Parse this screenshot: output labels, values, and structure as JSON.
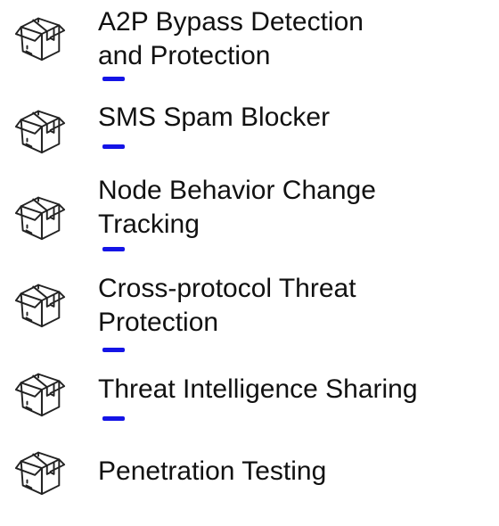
{
  "accent_color": "#1414e6",
  "icon_stroke_color": "#222222",
  "items": [
    {
      "label": "A2P Bypass Detection\nand Protection",
      "icon": "package-box-icon",
      "has_accent": true
    },
    {
      "label": "SMS Spam Blocker",
      "icon": "package-box-icon",
      "has_accent": true
    },
    {
      "label": "Node Behavior Change\nTracking",
      "icon": "package-box-icon",
      "has_accent": true
    },
    {
      "label": "Cross-protocol Threat\nProtection",
      "icon": "package-box-icon",
      "has_accent": true
    },
    {
      "label": "Threat Intelligence Sharing",
      "icon": "package-box-icon",
      "has_accent": true
    },
    {
      "label": "Penetration Testing",
      "icon": "package-box-icon",
      "has_accent": false
    }
  ]
}
